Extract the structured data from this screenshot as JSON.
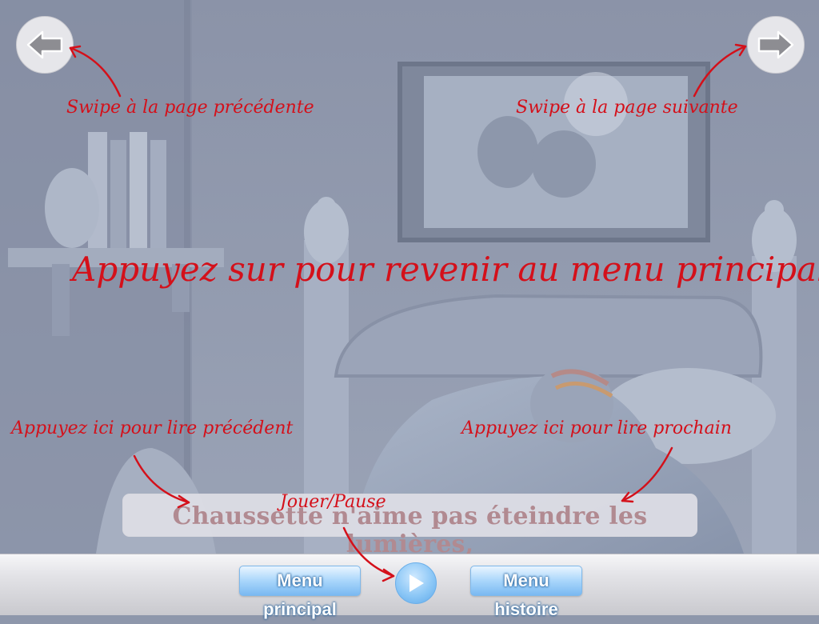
{
  "navigation": {
    "previous_icon": "arrow-left-icon",
    "next_icon": "arrow-right-icon"
  },
  "hints": {
    "swipe_previous": "Swipe à la page précédente",
    "swipe_next": "Swipe à la page suivante",
    "main_menu_tip": "Appuyez sur pour revenir au menu principal",
    "read_previous": "Appuyez ici pour lire précédent",
    "read_next": "Appuyez ici pour lire prochain",
    "play_pause": "Jouer/Pause"
  },
  "story": {
    "caption": "Chaussette n'aime pas éteindre les lumières,"
  },
  "toolbar": {
    "main_menu_label": "Menu principal",
    "play_icon": "play-icon",
    "story_menu_label": "Menu histoire"
  },
  "colors": {
    "hint_red": "#d4101a",
    "button_blue": "#7ab9f1",
    "scene_tint": "#8e97ab"
  }
}
